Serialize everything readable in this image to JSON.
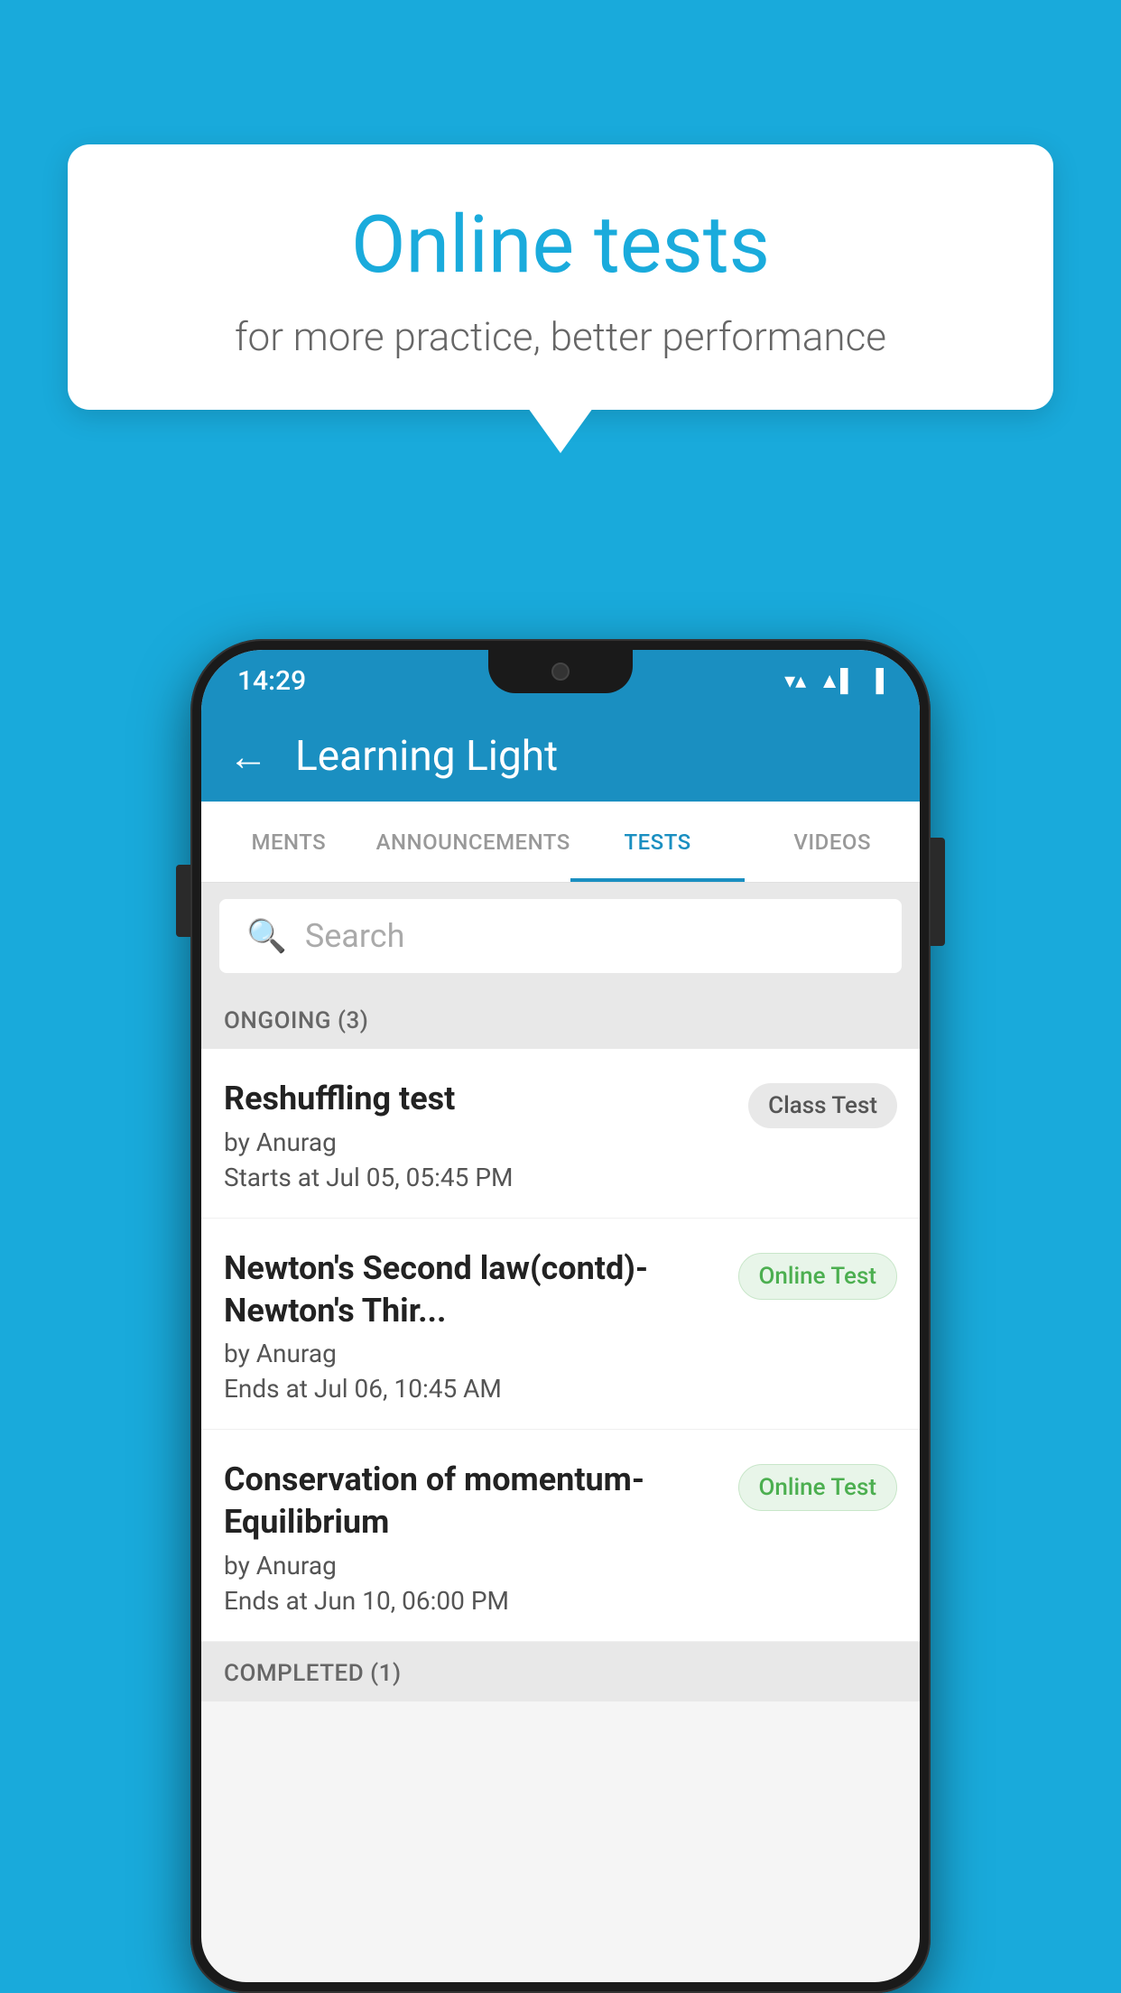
{
  "background": {
    "color": "#19AADB"
  },
  "speech_bubble": {
    "title": "Online tests",
    "subtitle": "for more practice, better performance"
  },
  "phone": {
    "status_bar": {
      "time": "14:29",
      "wifi": "▼▲",
      "battery": "▌"
    },
    "header": {
      "back_label": "←",
      "title": "Learning Light"
    },
    "tabs": [
      {
        "label": "MENTS",
        "active": false
      },
      {
        "label": "ANNOUNCEMENTS",
        "active": false
      },
      {
        "label": "TESTS",
        "active": true
      },
      {
        "label": "VIDEOS",
        "active": false
      }
    ],
    "search": {
      "placeholder": "Search"
    },
    "ongoing_section": {
      "title": "ONGOING (3)"
    },
    "tests": [
      {
        "name": "Reshuffling test",
        "author": "by Anurag",
        "time_label": "Starts at",
        "time": "Jul 05, 05:45 PM",
        "badge": "Class Test",
        "badge_type": "class"
      },
      {
        "name": "Newton's Second law(contd)-Newton's Thir...",
        "author": "by Anurag",
        "time_label": "Ends at",
        "time": "Jul 06, 10:45 AM",
        "badge": "Online Test",
        "badge_type": "online"
      },
      {
        "name": "Conservation of momentum-Equilibrium",
        "author": "by Anurag",
        "time_label": "Ends at",
        "time": "Jun 10, 06:00 PM",
        "badge": "Online Test",
        "badge_type": "online"
      }
    ],
    "completed_section": {
      "title": "COMPLETED (1)"
    }
  }
}
